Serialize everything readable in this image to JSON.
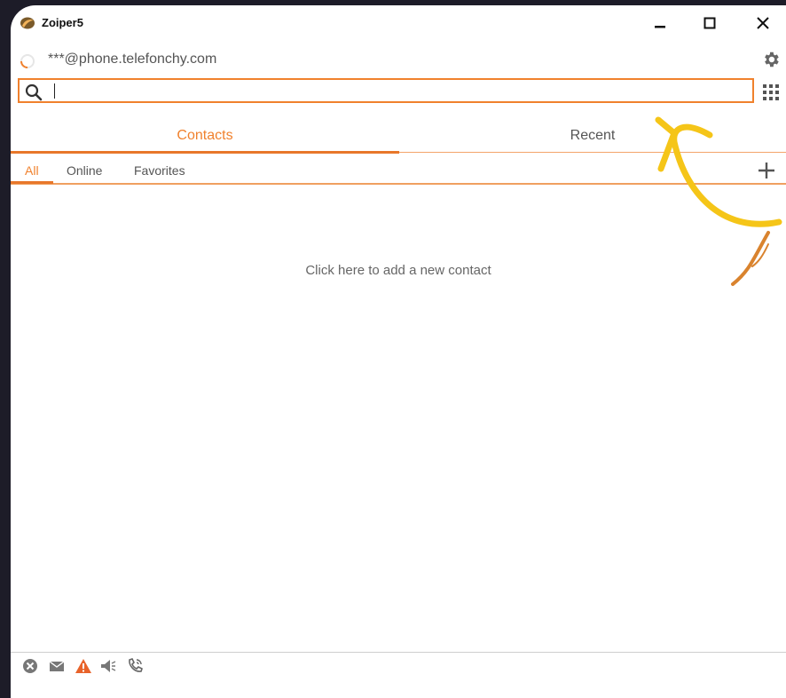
{
  "window": {
    "title": "Zoiper5"
  },
  "account": {
    "address": "***@phone.telefonchy.com"
  },
  "search": {
    "value": "",
    "placeholder": ""
  },
  "tabs": [
    {
      "label": "Contacts",
      "active": true
    },
    {
      "label": "Recent",
      "active": false
    }
  ],
  "filters": [
    {
      "label": "All",
      "active": true
    },
    {
      "label": "Online",
      "active": false
    },
    {
      "label": "Favorites",
      "active": false
    }
  ],
  "contacts": {
    "empty_message": "Click here to add a new contact"
  },
  "icons": {
    "app": "zoiper-logo-icon",
    "status": "registration-spinner-icon",
    "settings": "gear-icon",
    "search": "search-icon",
    "dialpad": "dialpad-icon",
    "add": "plus-icon",
    "statusbar": [
      "not-connected-icon",
      "messages-icon",
      "warning-icon",
      "speaker-icon",
      "call-icon"
    ]
  },
  "colors": {
    "accent": "#f0812d",
    "annotation_arrow": "#f5c518",
    "background": "#1d1c28",
    "warning": "#e8632a"
  }
}
